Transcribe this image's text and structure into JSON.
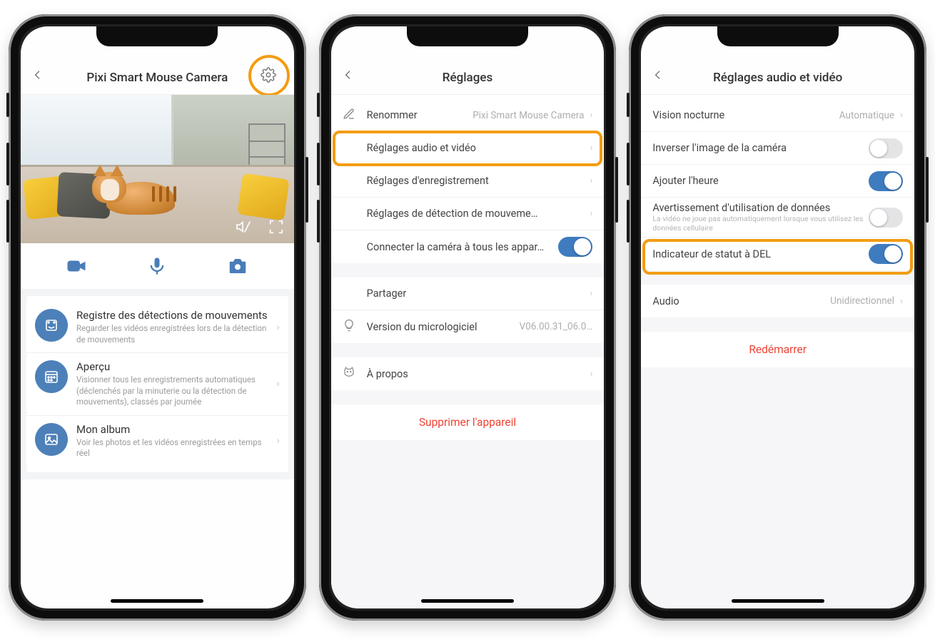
{
  "screen1": {
    "title": "Pixi Smart Mouse Camera",
    "rows": [
      {
        "title": "Registre des détections de mouvements",
        "sub": "Regarder les vidéos enregistrées lors de la détection de mouvements"
      },
      {
        "title": "Aperçu",
        "sub": "Visionner tous les enregistrements automatiques (déclenchés par la minuterie ou la détection de mouvements), classés par journée"
      },
      {
        "title": "Mon album",
        "sub": "Voir les photos et les vidéos enregistrées en temps réel"
      }
    ]
  },
  "screen2": {
    "title": "Réglages",
    "rows": {
      "rename": {
        "label": "Renommer",
        "value": "Pixi Smart Mouse Camera"
      },
      "av": {
        "label": "Réglages audio et vidéo"
      },
      "rec": {
        "label": "Réglages d'enregistrement"
      },
      "motion": {
        "label": "Réglages de détection de mouveme…"
      },
      "connect": {
        "label": "Connecter la caméra à tous les appar…"
      },
      "share": {
        "label": "Partager"
      },
      "fw": {
        "label": "Version du micrologiciel",
        "value": "V06.00.31_06.0…"
      },
      "about": {
        "label": "À propos"
      }
    },
    "delete": "Supprimer l'appareil"
  },
  "screen3": {
    "title": "Réglages audio et vidéo",
    "rows": {
      "night": {
        "label": "Vision nocturne",
        "value": "Automatique"
      },
      "flip": {
        "label": "Inverser l'image de la caméra"
      },
      "time": {
        "label": "Ajouter l'heure"
      },
      "data": {
        "label": "Avertissement d'utilisation de données",
        "sub": "La vidéo ne joue pas automatiquement lorsque vous utilisez les données cellulaire"
      },
      "led": {
        "label": "Indicateur de statut à DEL"
      },
      "audio": {
        "label": "Audio",
        "value": "Unidirectionnel"
      }
    },
    "restart": "Redémarrer"
  },
  "colors": {
    "highlight": "#f39c12",
    "accent": "#3f7bbf",
    "danger": "#e94c3d"
  }
}
